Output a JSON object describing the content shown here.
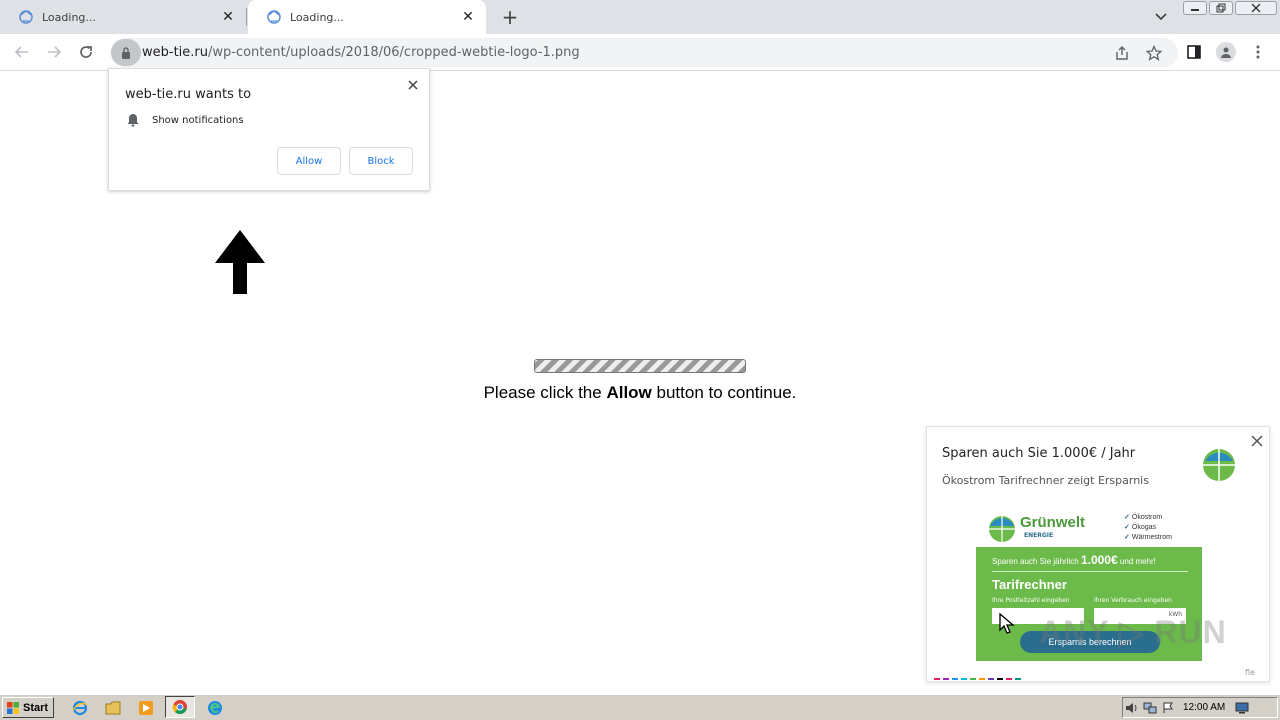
{
  "tabs": [
    {
      "title": "Loading...",
      "icon": "loading-globe-icon"
    },
    {
      "title": "Loading...",
      "icon": "loading-globe-icon",
      "active": true
    }
  ],
  "toolbar": {
    "url_domain": "web-tie.ru",
    "url_path": "/wp-content/uploads/2018/06/cropped-webtie-logo-1.png"
  },
  "permission_bubble": {
    "heading": "web-tie.ru wants to",
    "permission": "Show notifications",
    "allow_label": "Allow",
    "block_label": "Block"
  },
  "page": {
    "message_prefix": "Please click the ",
    "message_bold": "Allow",
    "message_suffix": " button to continue."
  },
  "ad": {
    "title": "Sparen auch Sie 1.000€ / Jahr",
    "subtitle": "Ökostrom Tarifrechner zeigt Ersparnis",
    "brand": "Grünwelt",
    "brand_sub": "ENERGIE",
    "features": [
      "Ökostrom",
      "Ökogas",
      "Wärmestrom"
    ],
    "promo_prefix": "Sparen auch Sie jährlich ",
    "promo_amount": "1.000€",
    "promo_suffix": " und mehr!",
    "calc_title": "Tarifrechner",
    "zip_label": "Ihre Postleitzahl eingeben",
    "usage_label": "Ihren Verbrauch eingeben",
    "usage_unit": "kWh",
    "cta": "Ersparnis berechnen",
    "footer": "fle",
    "watermark": "ANY ▷ RUN"
  },
  "taskbar": {
    "start_label": "Start",
    "clock": "12:00 AM"
  },
  "colors": {
    "link_blue": "#1a73e8",
    "ad_green": "#6cba4a",
    "ad_blue": "#2a6e8e",
    "tabstrip": "#dee1e6"
  }
}
